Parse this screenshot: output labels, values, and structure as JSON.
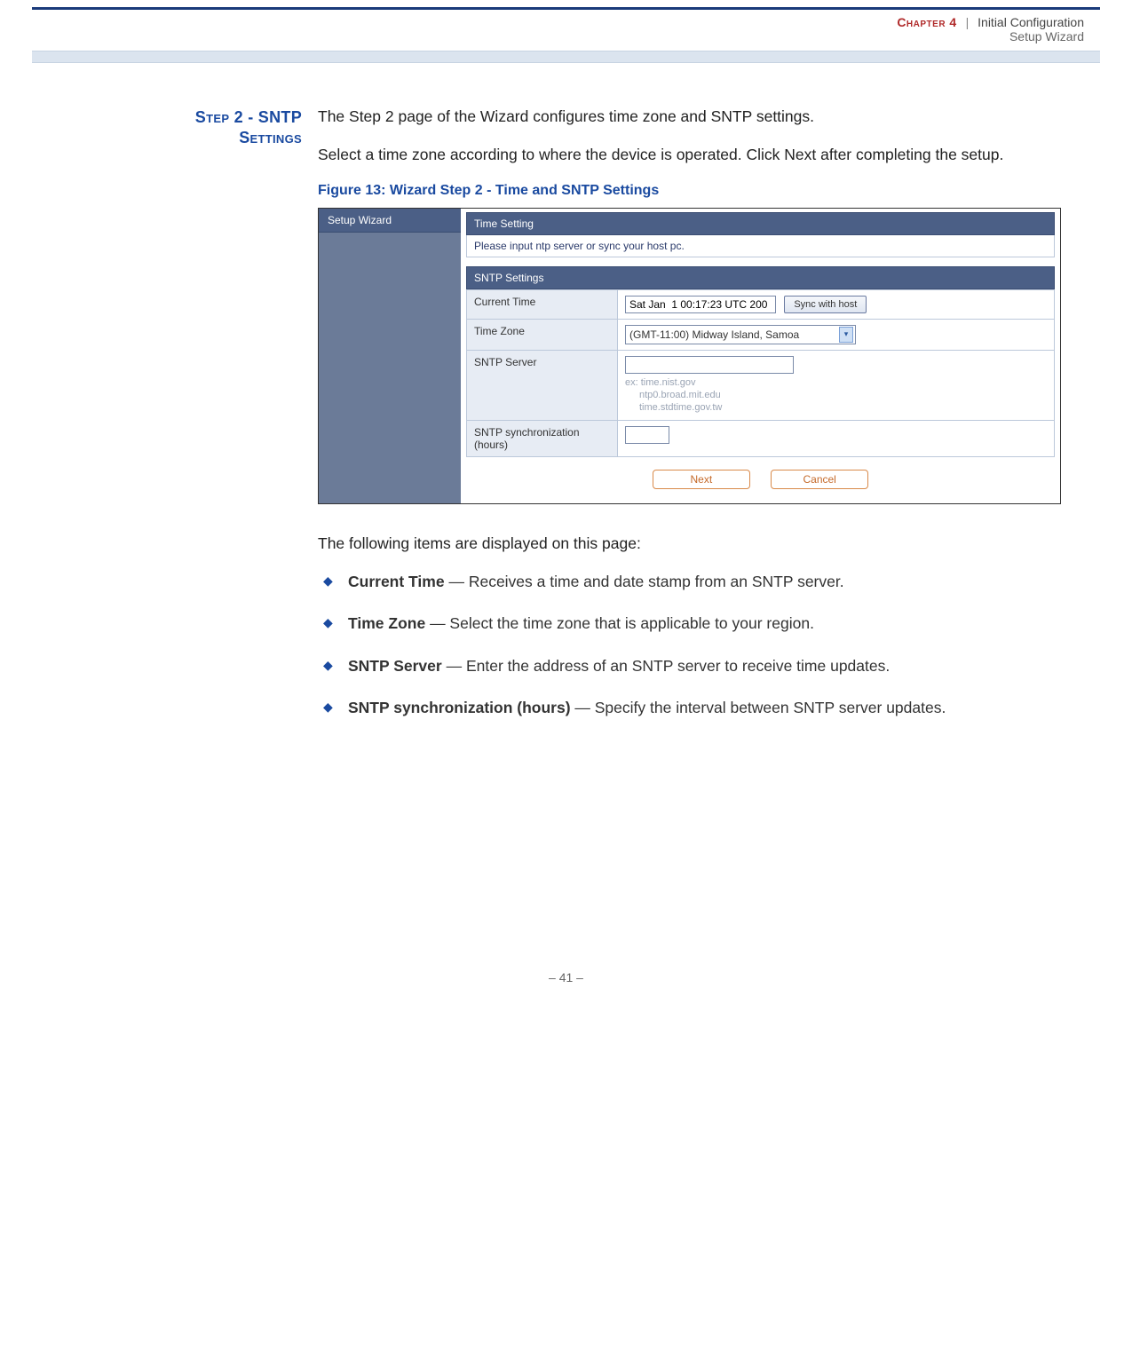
{
  "header": {
    "chapter_label": "Chapter 4",
    "separator": "|",
    "chapter_title": "Initial Configuration",
    "subheading": "Setup Wizard"
  },
  "margin_heading": {
    "line1": "Step 2 - SNTP",
    "line2": "Settings"
  },
  "intro": {
    "p1": "The Step 2 page of the Wizard configures time zone and SNTP settings.",
    "p2": "Select a time zone according to where the device is operated. Click Next after completing the setup."
  },
  "figure_caption": "Figure 13:  Wizard Step 2 - Time and SNTP Settings",
  "screenshot": {
    "sidebar_title": "Setup Wizard",
    "time_setting_title": "Time Setting",
    "time_setting_note": "Please input ntp server or sync your host pc.",
    "sntp_title": "SNTP Settings",
    "rows": {
      "current_time_label": "Current Time",
      "current_time_value": "Sat Jan  1 00:17:23 UTC 200",
      "sync_button": "Sync with host",
      "time_zone_label": "Time Zone",
      "time_zone_value": "(GMT-11:00) Midway Island, Samoa",
      "sntp_server_label": "SNTP Server",
      "sntp_server_value": "",
      "sntp_hint_prefix": "ex:",
      "sntp_hint_1": "time.nist.gov",
      "sntp_hint_2": "ntp0.broad.mit.edu",
      "sntp_hint_3": "time.stdtime.gov.tw",
      "sntp_sync_label": "SNTP synchronization (hours)",
      "sntp_sync_value": ""
    },
    "buttons": {
      "next": "Next",
      "cancel": "Cancel"
    }
  },
  "items_intro": "The following items are displayed on this page:",
  "bullets": [
    {
      "term": "Current Time",
      "desc": " — Receives a time and date stamp from an SNTP server."
    },
    {
      "term": "Time Zone",
      "desc": " —  Select the time zone that is applicable to your region."
    },
    {
      "term": "SNTP Server",
      "desc": " — Enter the address of an SNTP server to receive time updates."
    },
    {
      "term": "SNTP synchronization (hours)",
      "desc": " — Specify the interval between SNTP server updates."
    }
  ],
  "page_number": "–  41  –"
}
